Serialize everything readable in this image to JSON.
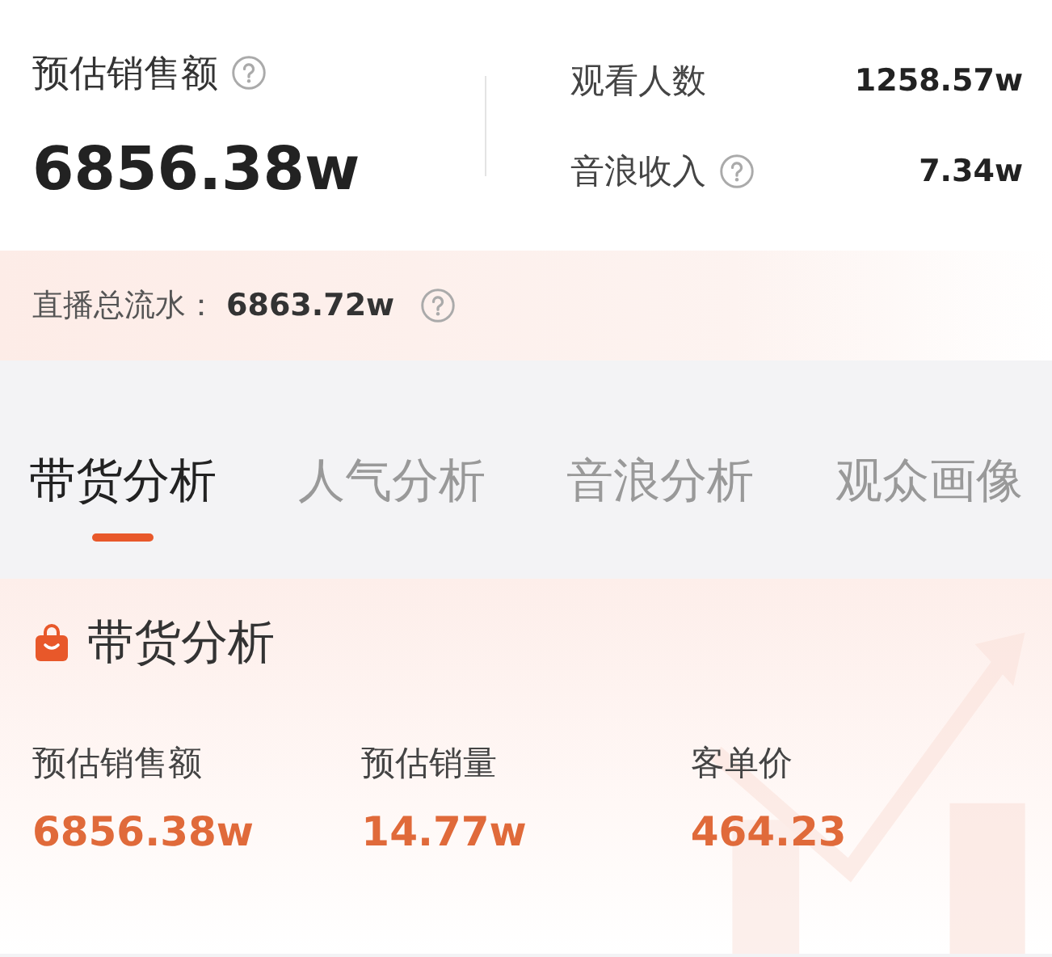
{
  "summary": {
    "main": {
      "label": "预估销售额",
      "value": "6856.38w",
      "help": true
    },
    "side": [
      {
        "label": "观看人数",
        "value": "1258.57w",
        "help": false
      },
      {
        "label": "音浪收入",
        "value": "7.34w",
        "help": true
      }
    ],
    "total": {
      "label": "直播总流水：",
      "value": "6863.72w",
      "help": true
    }
  },
  "tabs": [
    {
      "label": "带货分析",
      "selected": true
    },
    {
      "label": "人气分析",
      "selected": false
    },
    {
      "label": "音浪分析",
      "selected": false
    },
    {
      "label": "观众画像",
      "selected": false
    }
  ],
  "section": {
    "title": "带货分析",
    "metrics": [
      {
        "label": "预估销售额",
        "value": "6856.38w"
      },
      {
        "label": "预估销量",
        "value": "14.77w"
      },
      {
        "label": "客单价",
        "value": "464.23"
      }
    ]
  }
}
